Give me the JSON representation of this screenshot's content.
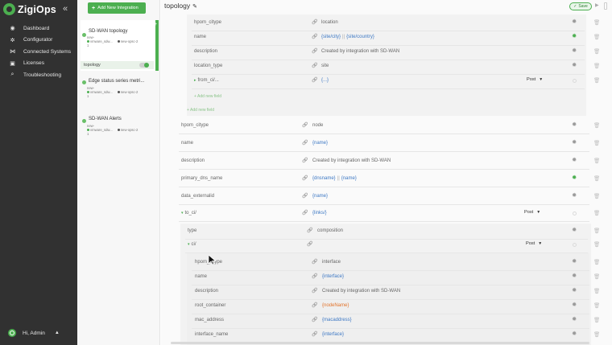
{
  "app": {
    "name": "ZigiOps"
  },
  "sidebar": {
    "collapse_icon": "double-chevron-left",
    "items": [
      {
        "label": "Dashboard",
        "icon": "dashboard"
      },
      {
        "label": "Configurator",
        "icon": "configurator-gear"
      },
      {
        "label": "Connected Systems",
        "icon": "connected-nodes"
      },
      {
        "label": "Licenses",
        "icon": "lock"
      },
      {
        "label": "Troubleshooting",
        "icon": "search"
      }
    ],
    "user": {
      "label": "Hi, Admin"
    }
  },
  "integrations": {
    "add_label": "Add New Integration",
    "cards": [
      {
        "title": "SD-WAN topology",
        "meta1": "new-",
        "meta2a": "vmware_sdw...",
        "meta2b": "new-opsc-2",
        "meta3": "1",
        "active": true,
        "flow_label": "topology"
      },
      {
        "title": "Edge status series metri...",
        "meta1": "new-",
        "meta2a": "vmware_sdw...",
        "meta2b": "new-opsc-2",
        "meta3": "1"
      },
      {
        "title": "SD-WAN Alerts",
        "meta1": "new-",
        "meta2a": "vmware_sdw...",
        "meta2b": "new-opsc-2",
        "meta3": "1"
      }
    ]
  },
  "main": {
    "title": "topology",
    "save_label": "Save",
    "nested_top": [
      {
        "name": "hpom_citype",
        "value": "location",
        "kind": "static"
      },
      {
        "name": "name",
        "value": "{site/city}",
        "value2": "{site/country}",
        "kind": "expr",
        "gear": "green"
      },
      {
        "name": "description",
        "value": "Created by integration with SD-WAN",
        "kind": "static"
      },
      {
        "name": "location_type",
        "value": "site",
        "kind": "static"
      },
      {
        "name": "from_ci/...",
        "value": "{...}",
        "kind": "expr",
        "tri": "▸",
        "post": "Post"
      }
    ],
    "add_new_field_inner": "+ Add new field",
    "add_new_field_outer": "+ Add new field",
    "outer_rows": [
      {
        "name": "hpom_citype",
        "value": "node",
        "kind": "static"
      },
      {
        "name": "name",
        "value": "{name}",
        "kind": "expr"
      },
      {
        "name": "description",
        "value": "Created by integration with SD-WAN",
        "kind": "static"
      },
      {
        "name": "primary_dns_name",
        "value": "{dnsname}",
        "value2": "{name}",
        "kind": "expr",
        "gear": "green"
      },
      {
        "name": "data_externalid",
        "value": "{name}",
        "kind": "expr"
      },
      {
        "name": "to_ci/",
        "value": "{links/}",
        "kind": "expr",
        "tri": "▾",
        "post": "Post"
      }
    ],
    "links_rows": [
      {
        "name": "type",
        "value": "composition",
        "kind": "static"
      },
      {
        "name": "ci/",
        "value": "",
        "kind": "static",
        "tri": "▾",
        "post": "Post"
      }
    ],
    "ci_rows": [
      {
        "name": "hpom_citype",
        "value": "interface",
        "kind": "static"
      },
      {
        "name": "name",
        "value": "{interface}",
        "kind": "expr"
      },
      {
        "name": "description",
        "value": "Created by integration with SD-WAN",
        "kind": "static"
      },
      {
        "name": "root_container",
        "value": "{nodeName}",
        "kind": "expr-o"
      },
      {
        "name": "mac_address",
        "value": "{macaddress}",
        "kind": "expr"
      },
      {
        "name": "interface_name",
        "value": "{interface}",
        "kind": "expr"
      }
    ]
  },
  "colors": {
    "brand_green": "#4caf50",
    "sidebar_bg": "#313131",
    "expr_blue": "#3d78c4",
    "expr_orange": "#e2732b"
  }
}
